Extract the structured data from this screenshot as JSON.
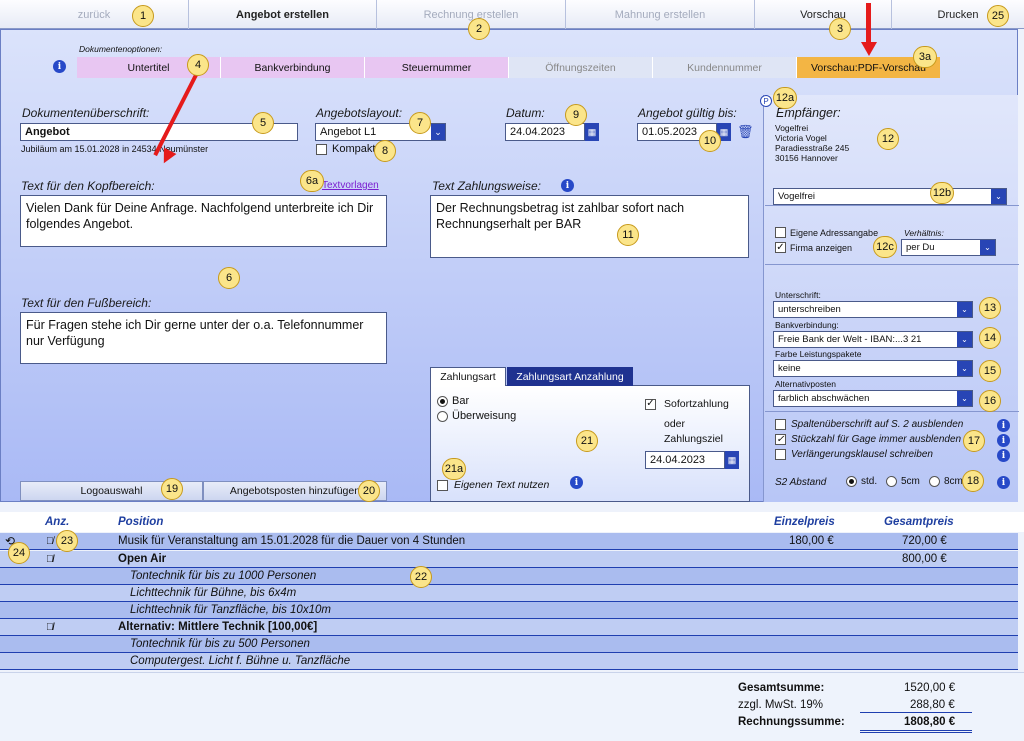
{
  "topnav": {
    "back": "zurück",
    "create_offer": "Angebot erstellen",
    "create_invoice": "Rechnung erstellen",
    "create_reminder": "Mahnung erstellen",
    "preview": "Vorschau",
    "print": "Drucken"
  },
  "docopts": {
    "heading": "Dokumentenoptionen:",
    "tabs": [
      "Untertitel",
      "Bankverbindung",
      "Steuernummer",
      "Öffnungszeiten",
      "Kundennummer",
      "Vorschau:PDF-Vorschau"
    ]
  },
  "form": {
    "title_label": "Dokumentenüberschrift:",
    "title_value": "Angebot",
    "subtitle_text": "Jubiläum am 15.01.2028 in 24534 Neumünster",
    "layout_label": "Angebotslayout:",
    "layout_value": "Angebot L1",
    "compact_label": "Kompakt",
    "date_label": "Datum:",
    "date_value": "24.04.2023",
    "valid_label": "Angebot gültig bis:",
    "valid_value": "01.05.2023",
    "head_text_label": "Text für den Kopfbereich:",
    "templates_link": "Textvorlagen",
    "head_text": "Vielen Dank für Deine Anfrage. Nachfolgend unterbreite ich Dir folgendes Angebot.",
    "payment_text_label": "Text Zahlungsweise:",
    "payment_text": "Der Rechnungsbetrag ist zahlbar sofort nach Rechnungserhalt per BAR",
    "foot_text_label": "Text für den Fußbereich:",
    "foot_text": "Für Fragen stehe ich Dir gerne unter der o.a. Telefonnummer nur Verfügung",
    "logo_button": "Logoauswahl",
    "add_items_button": "Angebotsposten hinzufügen"
  },
  "payment": {
    "tab_active": "Zahlungsart",
    "tab_other": "Zahlungsart Anzahlung",
    "opt_cash": "Bar",
    "opt_transfer": "Überweisung",
    "instant": "Sofortzahlung",
    "or_target": "oder",
    "target": "Zahlungsziel",
    "target_date": "24.04.2023",
    "own_text": "Eigenen Text nutzen"
  },
  "recipient": {
    "label": "Empfänger:",
    "p_marker": "P",
    "lines": [
      "Vogelfrei",
      "Victoria Vogel",
      "Paradiesstraße 245",
      "30156 Hannover"
    ],
    "select_value": "Vogelfrei",
    "own_address": "Eigene Adressangabe",
    "show_company": "Firma anzeigen",
    "relation_label": "Verhältnis:",
    "relation_value": "per Du",
    "signature_label": "Unterschrift:",
    "signature_value": "unterschreiben",
    "bank_label": "Bankverbindung:",
    "bank_value": "Freie Bank der Welt - IBAN:...3 21",
    "color_label": "Farbe Leistungspakete",
    "color_value": "keine",
    "alt_label": "Alternativposten",
    "alt_value": "farblich abschwächen",
    "chk1": "Spaltenüberschrift auf S. 2 ausblenden",
    "chk2": "Stückzahl für Gage immer ausblenden",
    "chk3": "Verlängerungsklausel schreiben",
    "spacing_label": "S2 Abstand",
    "sp_std": "std.",
    "sp_5": "5cm",
    "sp_8": "8cm"
  },
  "table": {
    "headers": {
      "qty": "Anz.",
      "position": "Position",
      "unit": "Einzelpreis",
      "total": "Gesamtpreis"
    },
    "rows": [
      {
        "text": "Musik für Veranstaltung am 15.01.2028 für die Dauer von 4 Stunden",
        "unit": "180,00 €",
        "total": "720,00 €"
      },
      {
        "text": "Open Air",
        "total": "800,00 €"
      },
      {
        "text": "Tontechnik für bis zu 1000 Personen"
      },
      {
        "text": "Lichttechnik für Bühne, bis 6x4m"
      },
      {
        "text": "Lichttechnik für Tanzfläche, bis 10x10m"
      },
      {
        "text": "Alternativ: Mittlere Technik [100,00€]"
      },
      {
        "text": "Tontechnik für bis zu 500 Personen"
      },
      {
        "text": "Computergest. Licht f. Bühne u. Tanzfläche"
      }
    ]
  },
  "totals": {
    "sum_label": "Gesamtsumme:",
    "sum": "1520,00 €",
    "vat_label": "zzgl. MwSt. 19%",
    "vat": "288,80 €",
    "invoice_label": "Rechnungssumme:",
    "invoice": "1808,80 €"
  },
  "badges": [
    "1",
    "2",
    "3",
    "3a",
    "4",
    "5",
    "6",
    "6a",
    "7",
    "8",
    "9",
    "10",
    "11",
    "12",
    "12a",
    "12b",
    "12c",
    "13",
    "14",
    "15",
    "16",
    "17",
    "18",
    "19",
    "20",
    "21",
    "21a",
    "22",
    "23",
    "24",
    "25"
  ],
  "colors": {
    "panel": "#a9b9f5",
    "accent": "#2845b5",
    "tab_pink": "#e8c6f2",
    "tab_active": "#f3b544",
    "badge": "#fbe58a",
    "arrow": "#e51b1b"
  }
}
